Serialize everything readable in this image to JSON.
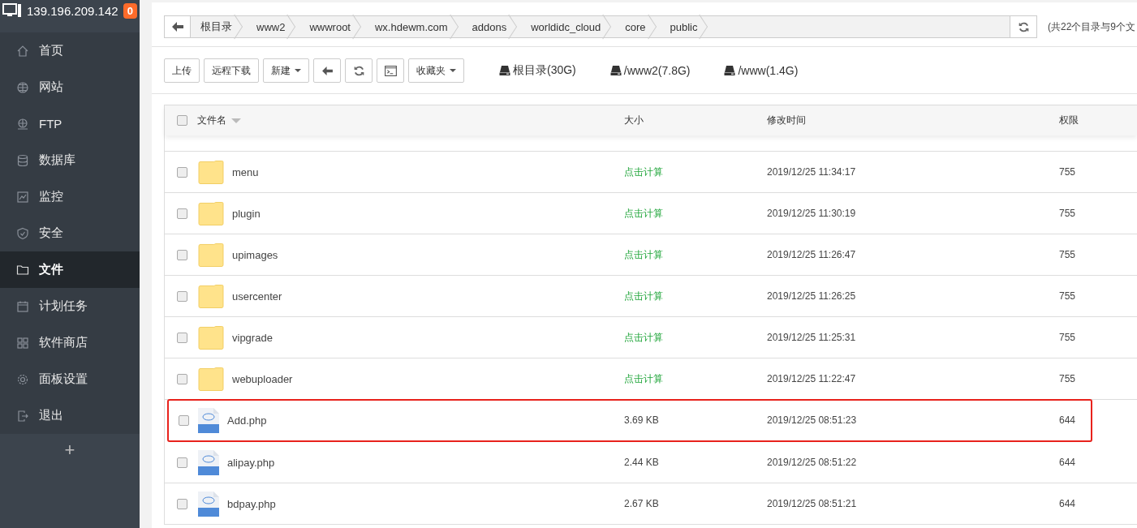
{
  "server": {
    "address": "139.196.209.142",
    "badge": "0"
  },
  "sidebar": {
    "items": [
      {
        "label": "首页",
        "selected": false
      },
      {
        "label": "网站",
        "selected": false
      },
      {
        "label": "FTP",
        "selected": false
      },
      {
        "label": "数据库",
        "selected": false
      },
      {
        "label": "监控",
        "selected": false
      },
      {
        "label": "安全",
        "selected": false
      },
      {
        "label": "文件",
        "selected": true
      },
      {
        "label": "计划任务",
        "selected": false
      },
      {
        "label": "软件商店",
        "selected": false
      },
      {
        "label": "面板设置",
        "selected": false
      },
      {
        "label": "退出",
        "selected": false
      }
    ],
    "add": "+"
  },
  "breadcrumb": [
    "根目录",
    "www2",
    "wwwroot",
    "wx.hdewm.com",
    "addons",
    "worldidc_cloud",
    "core",
    "public"
  ],
  "summary": "(共22个目录与9个文",
  "toolbar": {
    "buttons": [
      {
        "kind": "text",
        "label": "上传"
      },
      {
        "kind": "text",
        "label": "远程下载"
      },
      {
        "kind": "dropdown",
        "label": "新建"
      },
      {
        "kind": "back"
      },
      {
        "kind": "refresh"
      },
      {
        "kind": "terminal"
      },
      {
        "kind": "dropdown",
        "label": "收藏夹"
      }
    ],
    "disks": [
      "根目录(30G)",
      "/www2(7.8G)",
      "/www(1.4G)"
    ]
  },
  "table": {
    "select_all_checked": false,
    "columns": [
      "文件名",
      "大小",
      "修改时间",
      "权限"
    ],
    "rows": [
      {
        "kind": "folder",
        "name": "menu",
        "size": "点击计算",
        "modified": "2019/12/25 11:34:17",
        "permission": "755",
        "checked": false,
        "outlined": false
      },
      {
        "kind": "folder",
        "name": "plugin",
        "size": "点击计算",
        "modified": "2019/12/25 11:30:19",
        "permission": "755",
        "checked": false,
        "outlined": false
      },
      {
        "kind": "folder",
        "name": "upimages",
        "size": "点击计算",
        "modified": "2019/12/25 11:26:47",
        "permission": "755",
        "checked": false,
        "outlined": false
      },
      {
        "kind": "folder",
        "name": "usercenter",
        "size": "点击计算",
        "modified": "2019/12/25 11:26:25",
        "permission": "755",
        "checked": false,
        "outlined": false
      },
      {
        "kind": "folder",
        "name": "vipgrade",
        "size": "点击计算",
        "modified": "2019/12/25 11:25:31",
        "permission": "755",
        "checked": false,
        "outlined": false
      },
      {
        "kind": "folder",
        "name": "webuploader",
        "size": "点击计算",
        "modified": "2019/12/25 11:22:47",
        "permission": "755",
        "checked": false,
        "outlined": false
      },
      {
        "kind": "php",
        "name": "Add.php",
        "size": "3.69 KB",
        "modified": "2019/12/25 08:51:23",
        "permission": "644",
        "checked": false,
        "outlined": true
      },
      {
        "kind": "php",
        "name": "alipay.php",
        "size": "2.44 KB",
        "modified": "2019/12/25 08:51:22",
        "permission": "644",
        "checked": false,
        "outlined": false
      },
      {
        "kind": "php",
        "name": "bdpay.php",
        "size": "2.67 KB",
        "modified": "2019/12/25 08:51:21",
        "permission": "644",
        "checked": false,
        "outlined": false
      }
    ]
  }
}
